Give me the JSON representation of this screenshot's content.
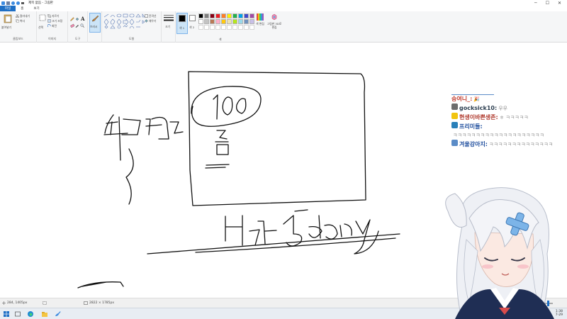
{
  "window": {
    "title": "제목 없음 - 그림판",
    "minimize": "─",
    "maximize": "☐",
    "close": "✕"
  },
  "tabs": [
    {
      "label": "파일"
    },
    {
      "label": "홈"
    },
    {
      "label": "보기"
    }
  ],
  "ribbon": {
    "clipboard": {
      "label": "클립보드",
      "paste": "붙여넣기",
      "cut": "잘라내기",
      "copy": "복사"
    },
    "image": {
      "label": "이미지",
      "select": "선택",
      "crop": "자르기",
      "resize": "크기 조정",
      "rotate": "회전"
    },
    "tools": {
      "label": "도구"
    },
    "brush": {
      "label": "브러시"
    },
    "shapes": {
      "label": "도형",
      "outline": "윤곽선",
      "fill": "채우기"
    },
    "size": {
      "label": "크기"
    },
    "color1": {
      "label": "색 1"
    },
    "color2": {
      "label": "색 2"
    },
    "colors": {
      "label": "색"
    },
    "edit_colors": {
      "label": "색 편집"
    },
    "paint3d": {
      "label": "그림판 3D로 편집"
    }
  },
  "palette": {
    "row1": [
      "#000000",
      "#7f7f7f",
      "#880015",
      "#ed1c24",
      "#ff7f27",
      "#fff200",
      "#22b14c",
      "#00a2e8",
      "#3f48cc",
      "#a349a4"
    ],
    "row2": [
      "#ffffff",
      "#c3c3c3",
      "#b97a57",
      "#ffaec9",
      "#ffc90e",
      "#efe4b0",
      "#b5e61d",
      "#99d9ea",
      "#7092be",
      "#c8bfe7"
    ],
    "color1": "#000000",
    "color2": "#ffffff"
  },
  "chat": [
    {
      "name": "승여니_:",
      "name_color": "#c0392b",
      "msg": "🎉",
      "badge": ""
    },
    {
      "name": "gocksick10:",
      "name_color": "#2c3e50",
      "msg": "우우",
      "badge": "#6d6d6d"
    },
    {
      "name": "현생이바쁜생존:",
      "name_color": "#b03a2e",
      "msg": "ㅎ ㅋㅋㅋㅋㅋ",
      "badge": "#f1c40f"
    },
    {
      "name": "프리미들:",
      "name_color": "#1f4e9e",
      "msg": "ㅋㅋㅋㅋㅋㅋㅋㅋㅋㅋㅋㅋㅋㅋㅋㅋㅋㅋㅋㅋ",
      "badge": "#2980b9"
    },
    {
      "name": "겨울강아지:",
      "name_color": "#1f4e9e",
      "msg": "ㅋㅋㅋㅋㅋㅋㅋㅋㅋㅋㅋㅋㅋㅋ",
      "badge": "#5b8cc7"
    }
  ],
  "status": {
    "cursor": "284, 1405px",
    "canvas_size": "2822 × 1785px"
  },
  "clock": {
    "time": "1:38",
    "date": "7-29"
  }
}
